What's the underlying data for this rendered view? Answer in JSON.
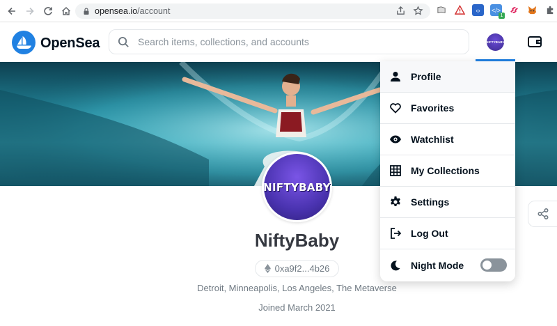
{
  "browser": {
    "url_host": "opensea.io",
    "url_path": "/account",
    "extension_badge": "1"
  },
  "header": {
    "brand": "OpenSea",
    "search_placeholder": "Search items, collections, and accounts",
    "avatar_text": "NIFTYBABY"
  },
  "profile": {
    "avatar_text": "NIFTYBABY",
    "name": "NiftyBaby",
    "address": "0xa9f2...4b26",
    "location": "Detroit, Minneapolis, Los Angeles, The Metaverse",
    "joined": "Joined March 2021"
  },
  "menu": {
    "items": [
      {
        "label": "Profile",
        "icon": "person-icon"
      },
      {
        "label": "Favorites",
        "icon": "heart-icon"
      },
      {
        "label": "Watchlist",
        "icon": "eye-icon"
      },
      {
        "label": "My Collections",
        "icon": "grid-icon"
      },
      {
        "label": "Settings",
        "icon": "gear-icon"
      },
      {
        "label": "Log Out",
        "icon": "logout-icon"
      },
      {
        "label": "Night Mode",
        "icon": "moon-icon"
      }
    ],
    "night_mode_on": false
  },
  "colors": {
    "brand_blue": "#2081e2",
    "text_dark": "#04111d",
    "text_muted": "#707a83"
  }
}
